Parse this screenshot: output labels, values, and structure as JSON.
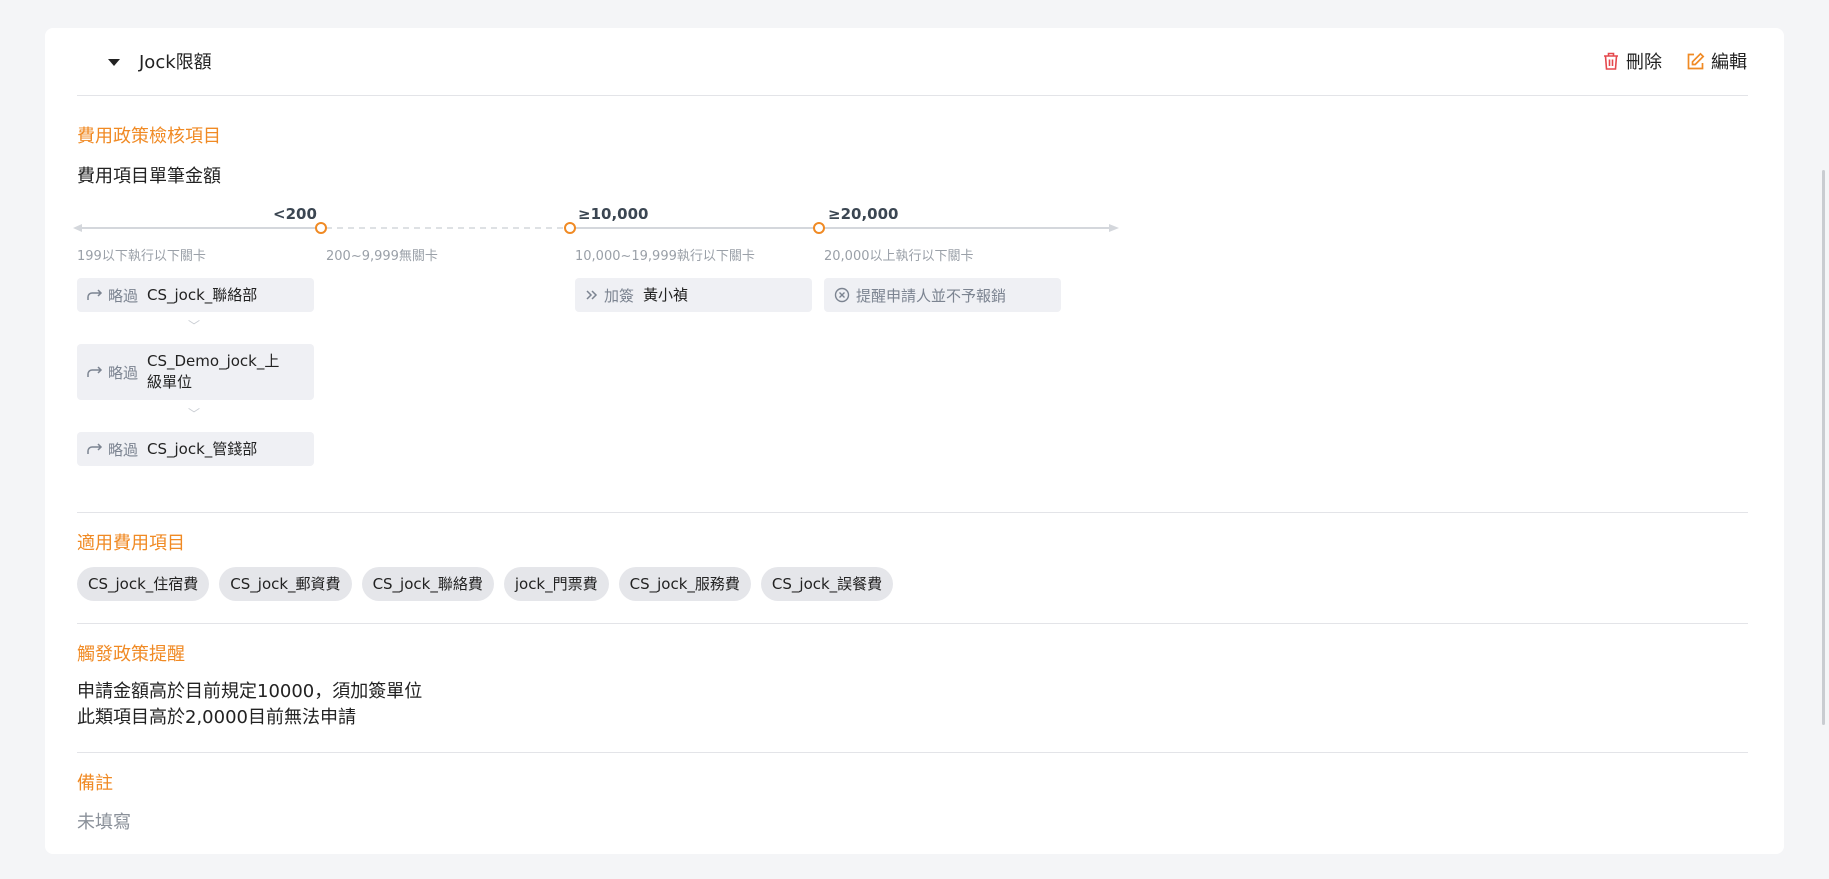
{
  "header": {
    "title": "Jock限額",
    "delete_label": "刪除",
    "edit_label": "編輯"
  },
  "policy": {
    "section_title": "費用政策檢核項目",
    "item_title": "費用項目單筆金額",
    "ticks": [
      "<200",
      "≥10,000",
      "≥20,000"
    ],
    "ranges": [
      "199以下執行以下關卡",
      "200~9,999無關卡",
      "10,000~19,999執行以下關卡",
      "20,000以上執行以下關卡"
    ],
    "steps_col1": [
      {
        "kind": "略過",
        "who": "CS_jock_聯絡部"
      },
      {
        "kind": "略過",
        "who": "CS_Demo_jock_上級單位"
      },
      {
        "kind": "略過",
        "who": "CS_jock_管錢部"
      }
    ],
    "step_col3": {
      "kind": "加簽",
      "who": "黃小禎"
    },
    "step_col4": {
      "text": "提醒申請人並不予報銷"
    }
  },
  "applicable": {
    "section_title": "適用費用項目",
    "tags": [
      "CS_jock_住宿費",
      "CS_jock_郵資費",
      "CS_jock_聯絡費",
      "jock_門票費",
      "CS_jock_服務費",
      "CS_jock_誤餐費"
    ]
  },
  "reminder": {
    "section_title": "觸發政策提醒",
    "lines": [
      "申請金額高於目前規定10000，須加簽單位",
      "此類項目高於2,0000目前無法申請"
    ]
  },
  "note": {
    "section_title": "備註",
    "text": "未填寫"
  },
  "colors": {
    "accent": "#f08a24",
    "delete": "#e5484d",
    "edit": "#f08a24"
  }
}
